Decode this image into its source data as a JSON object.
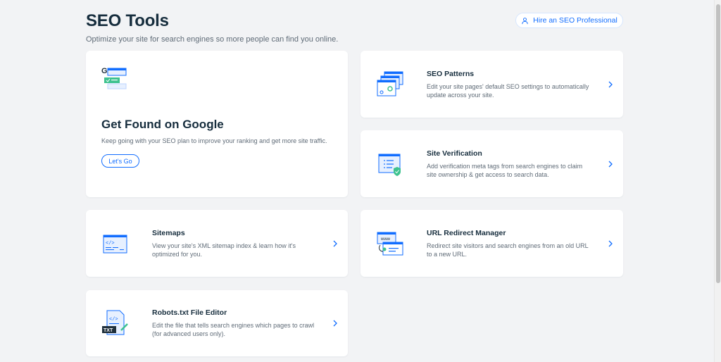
{
  "header": {
    "title": "SEO Tools",
    "subtitle": "Optimize your site for search engines so more people can find you online.",
    "hire_button": "Hire an SEO Professional"
  },
  "hero": {
    "title": "Get Found on Google",
    "description": "Keep going with your SEO plan to improve your ranking and get more site traffic.",
    "button": "Let's Go"
  },
  "cards": {
    "seo_patterns": {
      "title": "SEO Patterns",
      "description": "Edit your site pages' default SEO settings to automatically update across your site."
    },
    "site_verification": {
      "title": "Site Verification",
      "description": "Add verification meta tags from search engines to claim site ownership & get access to search data."
    },
    "sitemaps": {
      "title": "Sitemaps",
      "description": "View your site's XML sitemap index & learn how it's optimized for you."
    },
    "url_redirect": {
      "title": "URL Redirect Manager",
      "description": "Redirect site visitors and search engines from an old URL to a new URL."
    },
    "robots": {
      "title": "Robots.txt File Editor",
      "description": "Edit the file that tells search engines which pages to crawl (for advanced users only)."
    }
  },
  "illustrations": {
    "google_badge_letter": "G",
    "sitemap_code": "</>",
    "robots_code": "</>",
    "robots_label": "TXT",
    "www_label": "www"
  },
  "colors": {
    "accent": "#116dff",
    "background": "#f2f3f5",
    "title": "#162d3d",
    "secondary_text": "#5f6b77",
    "success": "#3ec28f"
  }
}
